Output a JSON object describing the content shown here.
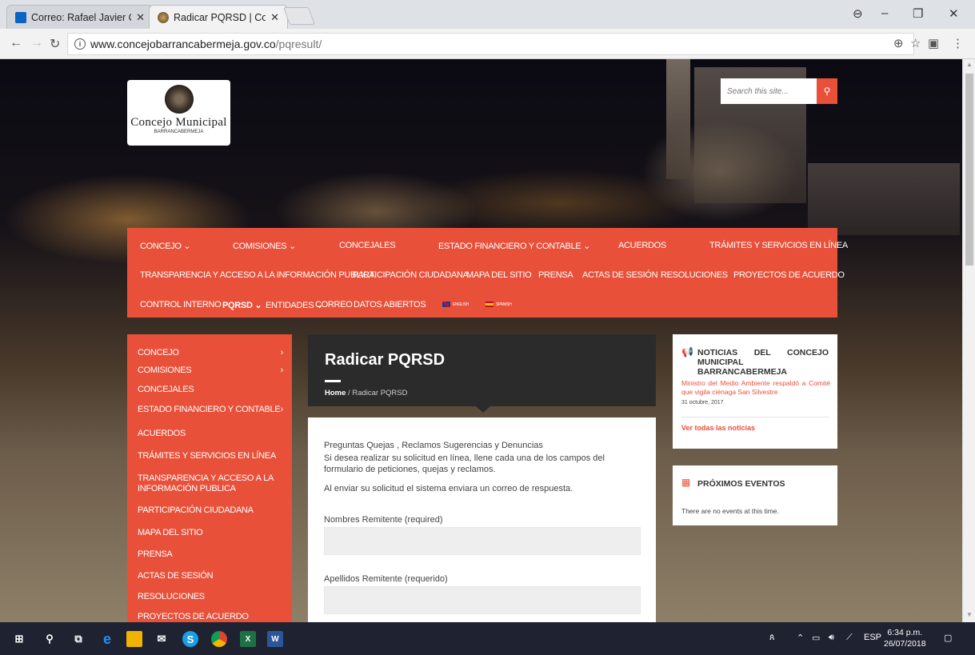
{
  "browser": {
    "tabs": [
      {
        "label": "Correo: Rafael Javier Can",
        "favicon": "outlook-icon"
      },
      {
        "label": "Radicar PQRSD | Concejo",
        "favicon": "concejo-icon"
      }
    ],
    "url_host": "www.concejobarrancabermeja.gov.co",
    "url_path": "/pqresult/"
  },
  "site": {
    "logo_name": "Concejo Municipal",
    "logo_sub": "BARRANCABERMEJA",
    "search_placeholder": "Search this site..."
  },
  "nav": {
    "row1": [
      "CONCEJO ⌄",
      "COMISIONES ⌄",
      "CONCEJALES",
      "ESTADO FINANCIERO Y CONTABLE ⌄",
      "ACUERDOS",
      "TRÁMITES Y SERVICIOS EN LÍNEA"
    ],
    "row2": [
      "TRANSPARENCIA Y ACCESO A LA INFORMACIÓN PUBLICA",
      "PARTICIPACIÓN CIUDADANA",
      "MAPA DEL SITIO",
      "PRENSA",
      "ACTAS DE SESIÓN",
      "RESOLUCIONES",
      "PROYECTOS DE ACUERDO"
    ],
    "row3": [
      "CONTROL INTERNO",
      "PQRSD ⌄",
      "ENTIDADES ⌄",
      "CORREO",
      "DATOS ABIERTOS",
      "ENGLISH",
      "SPANISH"
    ]
  },
  "sidebar": {
    "items": [
      "CONCEJO",
      "COMISIONES",
      "CONCEJALES",
      "ESTADO FINANCIERO Y CONTABLE",
      "ACUERDOS",
      "TRÁMITES Y SERVICIOS EN LÍNEA",
      "TRANSPARENCIA Y ACCESO A LA INFORMACIÓN PUBLICA",
      "PARTICIPACIÓN CIUDADANA",
      "MAPA DEL SITIO",
      "PRENSA",
      "ACTAS DE SESIÓN",
      "RESOLUCIONES",
      "PROYECTOS DE ACUERDO"
    ]
  },
  "content": {
    "title": "Radicar PQRSD",
    "breadcrumb_home": "Home",
    "breadcrumb_current": "Radicar PQRSD",
    "intro": [
      "Preguntas Quejas , Reclamos Sugerencias y Denuncias",
      "Si desea realizar su solicitud en línea, llene cada una de los campos del formulario de peticiones, quejas y reclamos.",
      "Al enviar su solicitud el sistema enviara un correo de respuesta."
    ],
    "fields": [
      {
        "label": "Nombres Remitente (required)",
        "value": ""
      },
      {
        "label": "Apellidos Remitente (requerido)",
        "value": ""
      }
    ]
  },
  "widgets": {
    "news_title": "NOTICIAS DEL CONCEJO MUNICIPAL BARRANCABERMEJA",
    "news_item": "Ministro del Medio Ambiente respaldó a Comité que vigila ciénaga San Silvestre",
    "news_date": "31 octubre, 2017",
    "news_link": "Ver todas las noticias",
    "events_title": "PRÓXIMOS EVENTOS",
    "events_empty": "There are no events at this time."
  },
  "taskbar": {
    "lang": "ESP",
    "time": "6:34 p.m.",
    "date": "26/07/2018"
  },
  "colors": {
    "accent": "#e8503a",
    "dark": "#2b2b2b"
  }
}
